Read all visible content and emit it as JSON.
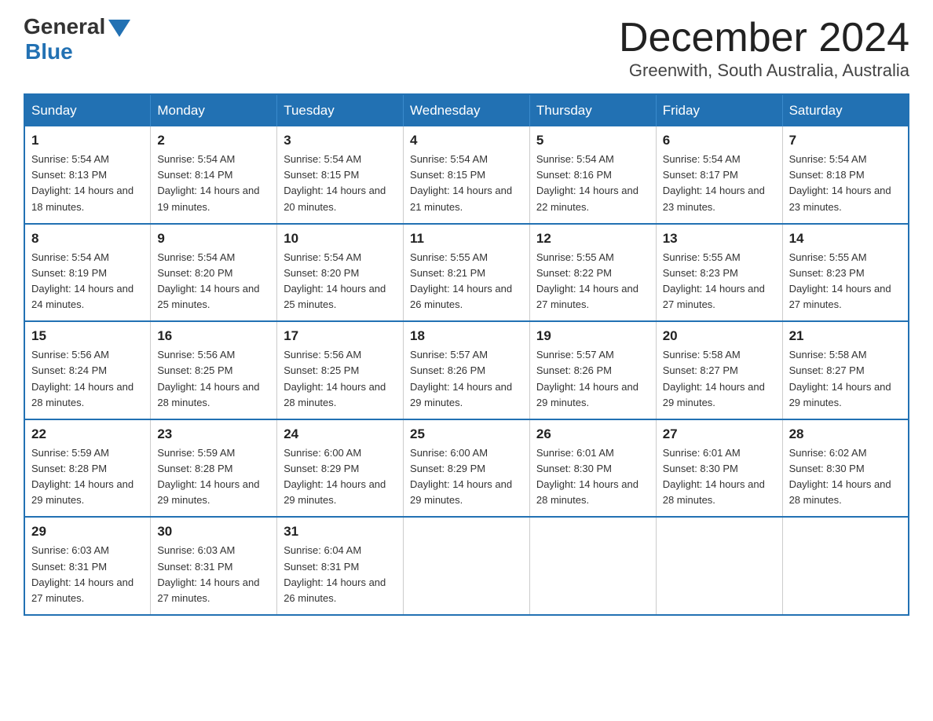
{
  "header": {
    "logo_general": "General",
    "logo_blue": "Blue",
    "title": "December 2024",
    "subtitle": "Greenwith, South Australia, Australia"
  },
  "days_of_week": [
    "Sunday",
    "Monday",
    "Tuesday",
    "Wednesday",
    "Thursday",
    "Friday",
    "Saturday"
  ],
  "weeks": [
    [
      {
        "num": "1",
        "sunrise": "5:54 AM",
        "sunset": "8:13 PM",
        "daylight": "14 hours and 18 minutes."
      },
      {
        "num": "2",
        "sunrise": "5:54 AM",
        "sunset": "8:14 PM",
        "daylight": "14 hours and 19 minutes."
      },
      {
        "num": "3",
        "sunrise": "5:54 AM",
        "sunset": "8:15 PM",
        "daylight": "14 hours and 20 minutes."
      },
      {
        "num": "4",
        "sunrise": "5:54 AM",
        "sunset": "8:15 PM",
        "daylight": "14 hours and 21 minutes."
      },
      {
        "num": "5",
        "sunrise": "5:54 AM",
        "sunset": "8:16 PM",
        "daylight": "14 hours and 22 minutes."
      },
      {
        "num": "6",
        "sunrise": "5:54 AM",
        "sunset": "8:17 PM",
        "daylight": "14 hours and 23 minutes."
      },
      {
        "num": "7",
        "sunrise": "5:54 AM",
        "sunset": "8:18 PM",
        "daylight": "14 hours and 23 minutes."
      }
    ],
    [
      {
        "num": "8",
        "sunrise": "5:54 AM",
        "sunset": "8:19 PM",
        "daylight": "14 hours and 24 minutes."
      },
      {
        "num": "9",
        "sunrise": "5:54 AM",
        "sunset": "8:20 PM",
        "daylight": "14 hours and 25 minutes."
      },
      {
        "num": "10",
        "sunrise": "5:54 AM",
        "sunset": "8:20 PM",
        "daylight": "14 hours and 25 minutes."
      },
      {
        "num": "11",
        "sunrise": "5:55 AM",
        "sunset": "8:21 PM",
        "daylight": "14 hours and 26 minutes."
      },
      {
        "num": "12",
        "sunrise": "5:55 AM",
        "sunset": "8:22 PM",
        "daylight": "14 hours and 27 minutes."
      },
      {
        "num": "13",
        "sunrise": "5:55 AM",
        "sunset": "8:23 PM",
        "daylight": "14 hours and 27 minutes."
      },
      {
        "num": "14",
        "sunrise": "5:55 AM",
        "sunset": "8:23 PM",
        "daylight": "14 hours and 27 minutes."
      }
    ],
    [
      {
        "num": "15",
        "sunrise": "5:56 AM",
        "sunset": "8:24 PM",
        "daylight": "14 hours and 28 minutes."
      },
      {
        "num": "16",
        "sunrise": "5:56 AM",
        "sunset": "8:25 PM",
        "daylight": "14 hours and 28 minutes."
      },
      {
        "num": "17",
        "sunrise": "5:56 AM",
        "sunset": "8:25 PM",
        "daylight": "14 hours and 28 minutes."
      },
      {
        "num": "18",
        "sunrise": "5:57 AM",
        "sunset": "8:26 PM",
        "daylight": "14 hours and 29 minutes."
      },
      {
        "num": "19",
        "sunrise": "5:57 AM",
        "sunset": "8:26 PM",
        "daylight": "14 hours and 29 minutes."
      },
      {
        "num": "20",
        "sunrise": "5:58 AM",
        "sunset": "8:27 PM",
        "daylight": "14 hours and 29 minutes."
      },
      {
        "num": "21",
        "sunrise": "5:58 AM",
        "sunset": "8:27 PM",
        "daylight": "14 hours and 29 minutes."
      }
    ],
    [
      {
        "num": "22",
        "sunrise": "5:59 AM",
        "sunset": "8:28 PM",
        "daylight": "14 hours and 29 minutes."
      },
      {
        "num": "23",
        "sunrise": "5:59 AM",
        "sunset": "8:28 PM",
        "daylight": "14 hours and 29 minutes."
      },
      {
        "num": "24",
        "sunrise": "6:00 AM",
        "sunset": "8:29 PM",
        "daylight": "14 hours and 29 minutes."
      },
      {
        "num": "25",
        "sunrise": "6:00 AM",
        "sunset": "8:29 PM",
        "daylight": "14 hours and 29 minutes."
      },
      {
        "num": "26",
        "sunrise": "6:01 AM",
        "sunset": "8:30 PM",
        "daylight": "14 hours and 28 minutes."
      },
      {
        "num": "27",
        "sunrise": "6:01 AM",
        "sunset": "8:30 PM",
        "daylight": "14 hours and 28 minutes."
      },
      {
        "num": "28",
        "sunrise": "6:02 AM",
        "sunset": "8:30 PM",
        "daylight": "14 hours and 28 minutes."
      }
    ],
    [
      {
        "num": "29",
        "sunrise": "6:03 AM",
        "sunset": "8:31 PM",
        "daylight": "14 hours and 27 minutes."
      },
      {
        "num": "30",
        "sunrise": "6:03 AM",
        "sunset": "8:31 PM",
        "daylight": "14 hours and 27 minutes."
      },
      {
        "num": "31",
        "sunrise": "6:04 AM",
        "sunset": "8:31 PM",
        "daylight": "14 hours and 26 minutes."
      },
      null,
      null,
      null,
      null
    ]
  ]
}
